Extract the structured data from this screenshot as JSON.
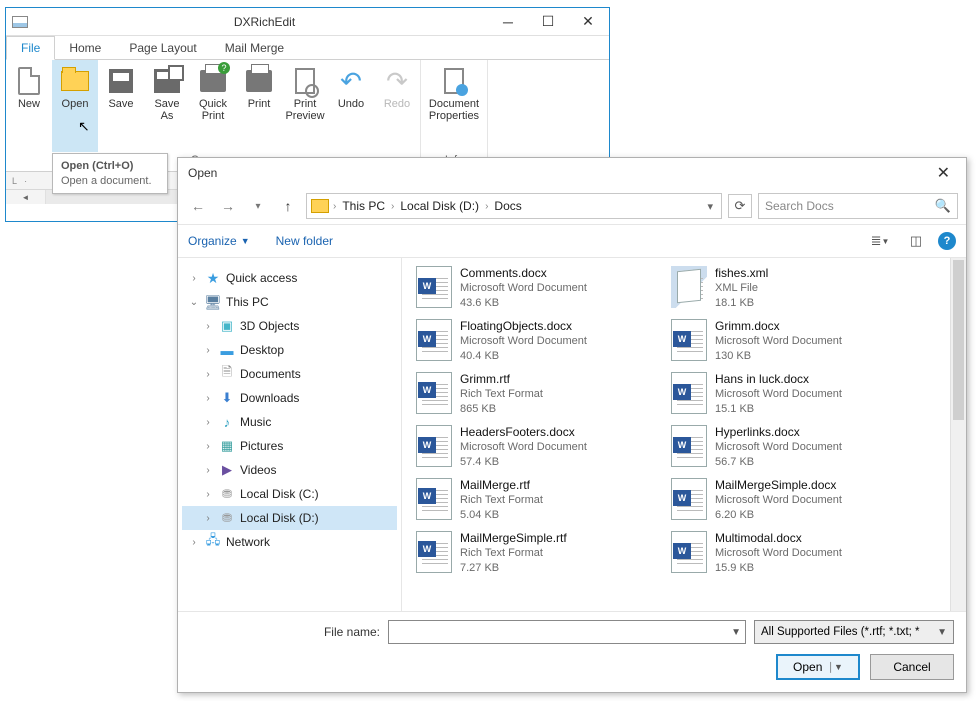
{
  "app": {
    "title": "DXRichEdit",
    "tabs": [
      "File",
      "Home",
      "Page Layout",
      "Mail Merge"
    ],
    "active_tab": 0,
    "ribbon_groups": [
      {
        "label": "Common",
        "items": [
          {
            "id": "new",
            "label": "New",
            "highlight": false
          },
          {
            "id": "open",
            "label": "Open",
            "highlight": true
          },
          {
            "id": "save",
            "label": "Save",
            "highlight": false
          },
          {
            "id": "saveas",
            "label": "Save\nAs",
            "highlight": false
          },
          {
            "id": "quickprint",
            "label": "Quick\nPrint",
            "highlight": false
          },
          {
            "id": "print",
            "label": "Print",
            "highlight": false
          },
          {
            "id": "preview",
            "label": "Print\nPreview",
            "highlight": false
          },
          {
            "id": "undo",
            "label": "Undo",
            "highlight": false
          },
          {
            "id": "redo",
            "label": "Redo",
            "highlight": false,
            "disabled": true
          }
        ]
      },
      {
        "label": "Info",
        "items": [
          {
            "id": "props",
            "label": "Document\nProperties",
            "highlight": false
          }
        ]
      }
    ],
    "tooltip": {
      "title": "Open (Ctrl+O)",
      "body": "Open a document."
    }
  },
  "dialog": {
    "title": "Open",
    "breadcrumb": [
      "This PC",
      "Local Disk (D:)",
      "Docs"
    ],
    "search_placeholder": "Search Docs",
    "toolbar": {
      "organize": "Organize",
      "new_folder": "New folder"
    },
    "tree": [
      {
        "label": "Quick access",
        "icon": "star",
        "exp": ">",
        "indent": 0
      },
      {
        "label": "This PC",
        "icon": "pc",
        "exp": "v",
        "indent": 0
      },
      {
        "label": "3D Objects",
        "icon": "cube",
        "exp": ">",
        "indent": 1
      },
      {
        "label": "Desktop",
        "icon": "desk",
        "exp": ">",
        "indent": 1
      },
      {
        "label": "Documents",
        "icon": "doc",
        "exp": ">",
        "indent": 1
      },
      {
        "label": "Downloads",
        "icon": "dl",
        "exp": ">",
        "indent": 1
      },
      {
        "label": "Music",
        "icon": "mus",
        "exp": ">",
        "indent": 1
      },
      {
        "label": "Pictures",
        "icon": "pic",
        "exp": ">",
        "indent": 1
      },
      {
        "label": "Videos",
        "icon": "vid",
        "exp": ">",
        "indent": 1
      },
      {
        "label": "Local Disk (C:)",
        "icon": "drv",
        "exp": ">",
        "indent": 1
      },
      {
        "label": "Local Disk (D:)",
        "icon": "drv",
        "exp": ">",
        "indent": 1,
        "selected": true
      },
      {
        "label": "Network",
        "icon": "net",
        "exp": ">",
        "indent": 0
      }
    ],
    "files_col1": [
      {
        "name": "Comments.docx",
        "type": "Microsoft Word Document",
        "size": "43.6 KB",
        "kind": "word"
      },
      {
        "name": "FloatingObjects.docx",
        "type": "Microsoft Word Document",
        "size": "40.4 KB",
        "kind": "word"
      },
      {
        "name": "Grimm.rtf",
        "type": "Rich Text Format",
        "size": "865 KB",
        "kind": "rtf"
      },
      {
        "name": "HeadersFooters.docx",
        "type": "Microsoft Word Document",
        "size": "57.4 KB",
        "kind": "word"
      },
      {
        "name": "MailMerge.rtf",
        "type": "Rich Text Format",
        "size": "5.04 KB",
        "kind": "rtf"
      },
      {
        "name": "MailMergeSimple.rtf",
        "type": "Rich Text Format",
        "size": "7.27 KB",
        "kind": "rtf"
      }
    ],
    "files_col2": [
      {
        "name": "fishes.xml",
        "type": "XML File",
        "size": "18.1 KB",
        "kind": "xml"
      },
      {
        "name": "Grimm.docx",
        "type": "Microsoft Word Document",
        "size": "130 KB",
        "kind": "word"
      },
      {
        "name": "Hans in luck.docx",
        "type": "Microsoft Word Document",
        "size": "15.1 KB",
        "kind": "word"
      },
      {
        "name": "Hyperlinks.docx",
        "type": "Microsoft Word Document",
        "size": "56.7 KB",
        "kind": "word"
      },
      {
        "name": "MailMergeSimple.docx",
        "type": "Microsoft Word Document",
        "size": "6.20 KB",
        "kind": "word"
      },
      {
        "name": "Multimodal.docx",
        "type": "Microsoft Word Document",
        "size": "15.9 KB",
        "kind": "word"
      }
    ],
    "filename_label": "File name:",
    "filename_value": "",
    "filter": "All Supported Files (*.rtf; *.txt; *",
    "open_btn": "Open",
    "cancel_btn": "Cancel"
  }
}
